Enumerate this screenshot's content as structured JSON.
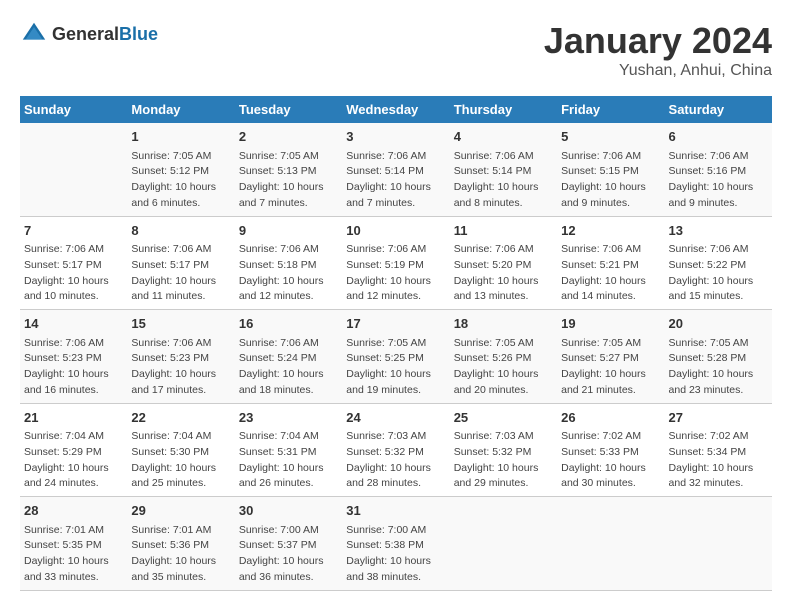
{
  "header": {
    "logo_general": "General",
    "logo_blue": "Blue",
    "month": "January 2024",
    "location": "Yushan, Anhui, China"
  },
  "calendar": {
    "days_of_week": [
      "Sunday",
      "Monday",
      "Tuesday",
      "Wednesday",
      "Thursday",
      "Friday",
      "Saturday"
    ],
    "weeks": [
      [
        {
          "day": "",
          "info": ""
        },
        {
          "day": "1",
          "info": "Sunrise: 7:05 AM\nSunset: 5:12 PM\nDaylight: 10 hours\nand 6 minutes."
        },
        {
          "day": "2",
          "info": "Sunrise: 7:05 AM\nSunset: 5:13 PM\nDaylight: 10 hours\nand 7 minutes."
        },
        {
          "day": "3",
          "info": "Sunrise: 7:06 AM\nSunset: 5:14 PM\nDaylight: 10 hours\nand 7 minutes."
        },
        {
          "day": "4",
          "info": "Sunrise: 7:06 AM\nSunset: 5:14 PM\nDaylight: 10 hours\nand 8 minutes."
        },
        {
          "day": "5",
          "info": "Sunrise: 7:06 AM\nSunset: 5:15 PM\nDaylight: 10 hours\nand 9 minutes."
        },
        {
          "day": "6",
          "info": "Sunrise: 7:06 AM\nSunset: 5:16 PM\nDaylight: 10 hours\nand 9 minutes."
        }
      ],
      [
        {
          "day": "7",
          "info": "Sunrise: 7:06 AM\nSunset: 5:17 PM\nDaylight: 10 hours\nand 10 minutes."
        },
        {
          "day": "8",
          "info": "Sunrise: 7:06 AM\nSunset: 5:17 PM\nDaylight: 10 hours\nand 11 minutes."
        },
        {
          "day": "9",
          "info": "Sunrise: 7:06 AM\nSunset: 5:18 PM\nDaylight: 10 hours\nand 12 minutes."
        },
        {
          "day": "10",
          "info": "Sunrise: 7:06 AM\nSunset: 5:19 PM\nDaylight: 10 hours\nand 12 minutes."
        },
        {
          "day": "11",
          "info": "Sunrise: 7:06 AM\nSunset: 5:20 PM\nDaylight: 10 hours\nand 13 minutes."
        },
        {
          "day": "12",
          "info": "Sunrise: 7:06 AM\nSunset: 5:21 PM\nDaylight: 10 hours\nand 14 minutes."
        },
        {
          "day": "13",
          "info": "Sunrise: 7:06 AM\nSunset: 5:22 PM\nDaylight: 10 hours\nand 15 minutes."
        }
      ],
      [
        {
          "day": "14",
          "info": "Sunrise: 7:06 AM\nSunset: 5:23 PM\nDaylight: 10 hours\nand 16 minutes."
        },
        {
          "day": "15",
          "info": "Sunrise: 7:06 AM\nSunset: 5:23 PM\nDaylight: 10 hours\nand 17 minutes."
        },
        {
          "day": "16",
          "info": "Sunrise: 7:06 AM\nSunset: 5:24 PM\nDaylight: 10 hours\nand 18 minutes."
        },
        {
          "day": "17",
          "info": "Sunrise: 7:05 AM\nSunset: 5:25 PM\nDaylight: 10 hours\nand 19 minutes."
        },
        {
          "day": "18",
          "info": "Sunrise: 7:05 AM\nSunset: 5:26 PM\nDaylight: 10 hours\nand 20 minutes."
        },
        {
          "day": "19",
          "info": "Sunrise: 7:05 AM\nSunset: 5:27 PM\nDaylight: 10 hours\nand 21 minutes."
        },
        {
          "day": "20",
          "info": "Sunrise: 7:05 AM\nSunset: 5:28 PM\nDaylight: 10 hours\nand 23 minutes."
        }
      ],
      [
        {
          "day": "21",
          "info": "Sunrise: 7:04 AM\nSunset: 5:29 PM\nDaylight: 10 hours\nand 24 minutes."
        },
        {
          "day": "22",
          "info": "Sunrise: 7:04 AM\nSunset: 5:30 PM\nDaylight: 10 hours\nand 25 minutes."
        },
        {
          "day": "23",
          "info": "Sunrise: 7:04 AM\nSunset: 5:31 PM\nDaylight: 10 hours\nand 26 minutes."
        },
        {
          "day": "24",
          "info": "Sunrise: 7:03 AM\nSunset: 5:32 PM\nDaylight: 10 hours\nand 28 minutes."
        },
        {
          "day": "25",
          "info": "Sunrise: 7:03 AM\nSunset: 5:32 PM\nDaylight: 10 hours\nand 29 minutes."
        },
        {
          "day": "26",
          "info": "Sunrise: 7:02 AM\nSunset: 5:33 PM\nDaylight: 10 hours\nand 30 minutes."
        },
        {
          "day": "27",
          "info": "Sunrise: 7:02 AM\nSunset: 5:34 PM\nDaylight: 10 hours\nand 32 minutes."
        }
      ],
      [
        {
          "day": "28",
          "info": "Sunrise: 7:01 AM\nSunset: 5:35 PM\nDaylight: 10 hours\nand 33 minutes."
        },
        {
          "day": "29",
          "info": "Sunrise: 7:01 AM\nSunset: 5:36 PM\nDaylight: 10 hours\nand 35 minutes."
        },
        {
          "day": "30",
          "info": "Sunrise: 7:00 AM\nSunset: 5:37 PM\nDaylight: 10 hours\nand 36 minutes."
        },
        {
          "day": "31",
          "info": "Sunrise: 7:00 AM\nSunset: 5:38 PM\nDaylight: 10 hours\nand 38 minutes."
        },
        {
          "day": "",
          "info": ""
        },
        {
          "day": "",
          "info": ""
        },
        {
          "day": "",
          "info": ""
        }
      ]
    ]
  }
}
